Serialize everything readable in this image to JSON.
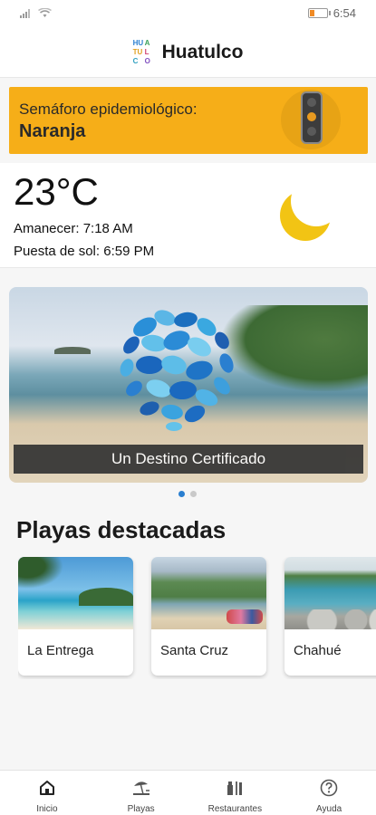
{
  "status_bar": {
    "time": "6:54"
  },
  "header": {
    "title": "Huatulco",
    "logo_letters": [
      "HU",
      "A",
      "TU",
      "L",
      "C",
      "O"
    ]
  },
  "semaforo": {
    "label": "Semáforo epidemiológico:",
    "value": "Naranja",
    "color": "#f6ae18"
  },
  "weather": {
    "temperature": "23°C",
    "sunrise": "Amanecer: 7:18 AM",
    "sunset": "Puesta de sol: 6:59 PM",
    "icon": "crescent-moon-icon"
  },
  "carousel": {
    "caption": "Un Destino Certificado",
    "slide_count": 2,
    "active_index": 0
  },
  "featured": {
    "title": "Playas destacadas",
    "beaches": [
      {
        "name": "La Entrega"
      },
      {
        "name": "Santa Cruz"
      },
      {
        "name": "Chahué"
      }
    ]
  },
  "nav": {
    "items": [
      {
        "label": "Inicio",
        "icon": "home-icon"
      },
      {
        "label": "Playas",
        "icon": "beach-icon"
      },
      {
        "label": "Restaurantes",
        "icon": "restaurant-icon"
      },
      {
        "label": "Ayuda",
        "icon": "help-icon"
      }
    ]
  },
  "colors": {
    "accent": "#2a7fd0",
    "moon": "#f2c414"
  }
}
